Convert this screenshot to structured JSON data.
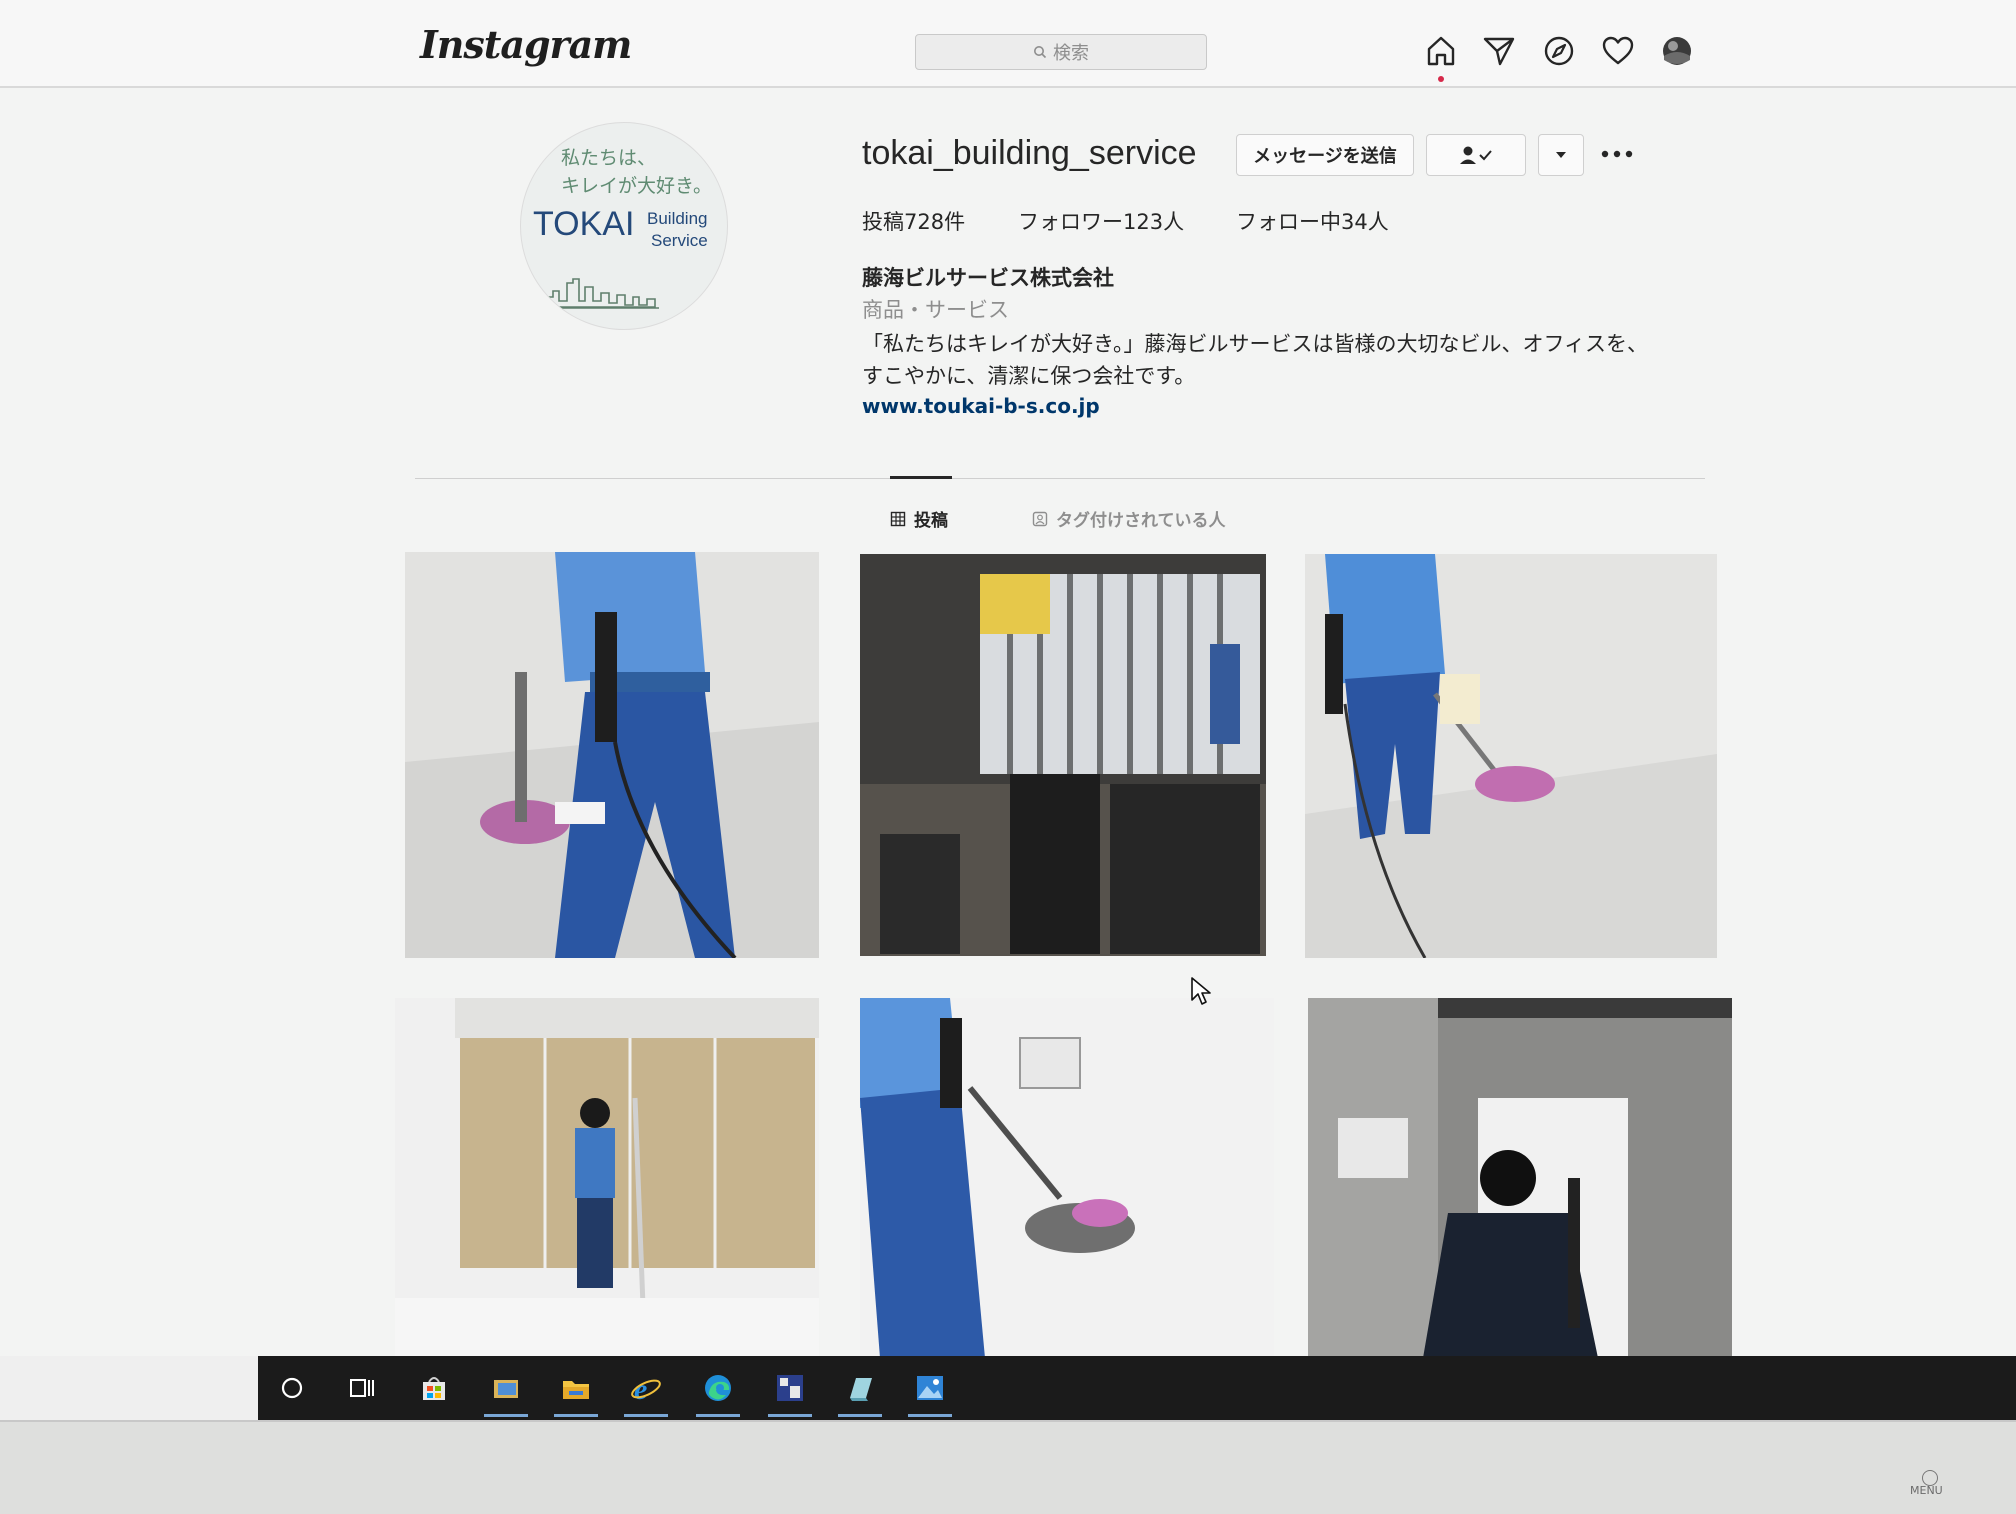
{
  "header": {
    "logo": "Instagram",
    "search_placeholder": "検索"
  },
  "profile": {
    "avatar": {
      "line1": "私たちは、",
      "line2": "キレイが大好き。",
      "brand": "TOKAI",
      "building": "Building",
      "service": "Service"
    },
    "username": "tokai_building_service",
    "message_button": "メッセージを送信",
    "stats": {
      "posts": "投稿728件",
      "followers": "フォロワー123人",
      "following": "フォロー中34人"
    },
    "full_name": "藤海ビルサービス株式会社",
    "category": "商品・サービス",
    "bio_line1": "「私たちはキレイが大好き。」藤海ビルサービスは皆様の大切なビル、オフィスを、",
    "bio_line2": "すこやかに、清潔に保つ会社です。",
    "website": "www.toukai-b-s.co.jp"
  },
  "tabs": {
    "posts": "投稿",
    "tagged": "タグ付けされている人"
  },
  "bezel": {
    "menu": "MENU"
  },
  "colors": {
    "link": "#00376b",
    "notification_dot": "#d6294a",
    "uniform_blue": "#4f8ed8"
  }
}
